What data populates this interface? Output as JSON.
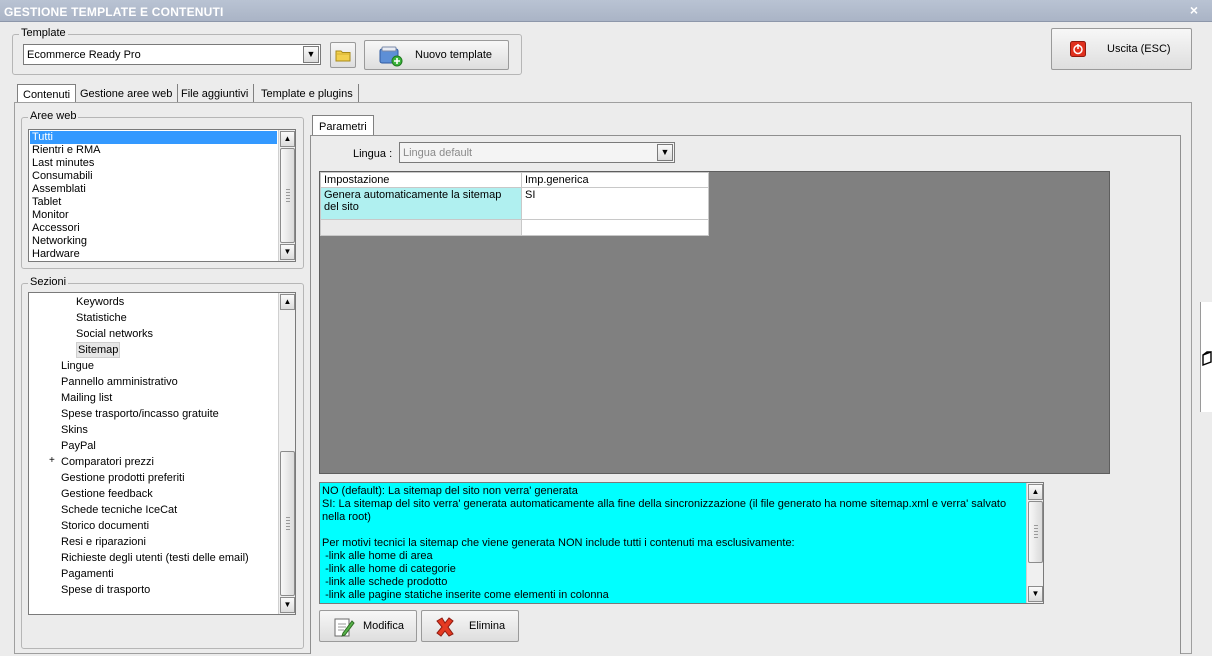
{
  "window": {
    "title": "GESTIONE TEMPLATE E CONTENUTI",
    "close_glyph": "×"
  },
  "template_group": {
    "label": "Template",
    "selected": "Ecommerce Ready Pro",
    "new_button": "Nuovo template"
  },
  "exit_button": "Uscita (ESC)",
  "main_tabs": [
    "Contenuti",
    "Gestione aree web",
    "File aggiuntivi",
    "Template e plugins"
  ],
  "aree_web": {
    "label": "Aree web",
    "items": [
      "Tutti",
      "Rientri e RMA",
      "Last minutes",
      "Consumabili",
      "Assemblati",
      "Tablet",
      "Monitor",
      "Accessori",
      "Networking",
      "Hardware"
    ],
    "selected_index": 0
  },
  "sezioni": {
    "label": "Sezioni",
    "children": [
      "Keywords",
      "Statistiche",
      "Social networks",
      "Sitemap"
    ],
    "selected_child": "Sitemap",
    "items": [
      "Lingue",
      "Pannello amministrativo",
      "Mailing list",
      "Spese trasporto/incasso gratuite",
      "Skins",
      "PayPal",
      "Comparatori prezzi",
      "Gestione prodotti preferiti",
      "Gestione feedback",
      "Schede tecniche IceCat",
      "Storico documenti",
      "Resi e riparazioni",
      "Richieste degli utenti (testi delle email)",
      "Pagamenti",
      "Spese di trasporto"
    ],
    "expandable": "Comparatori prezzi"
  },
  "parametri_tab": "Parametri",
  "lingua": {
    "label": "Lingua :",
    "value": "Lingua default"
  },
  "grid": {
    "headers": [
      "Impostazione",
      "Imp.generica"
    ],
    "rows": [
      {
        "setting": "Genera automaticamente la sitemap del sito",
        "value": "SI"
      }
    ]
  },
  "description": "NO (default): La sitemap del sito non verra' generata\nSI: La sitemap del sito verra' generata automaticamente alla fine della sincronizzazione (il file generato ha nome sitemap.xml e verra' salvato nella root)\n\nPer motivi tecnici la sitemap che viene generata NON include tutti i contenuti ma esclusivamente:\n -link alle home di area\n -link alle home di categorie\n -link alle schede prodotto\n -link alle pagine statiche inserite come elementi in colonna",
  "actions": {
    "modify": "Modifica",
    "delete": "Elimina"
  },
  "colors": {
    "selection": "#3399ff",
    "description_bg": "#00ffff",
    "grid_highlight": "#b0f0f0",
    "titlebar": "#aab4c6"
  }
}
